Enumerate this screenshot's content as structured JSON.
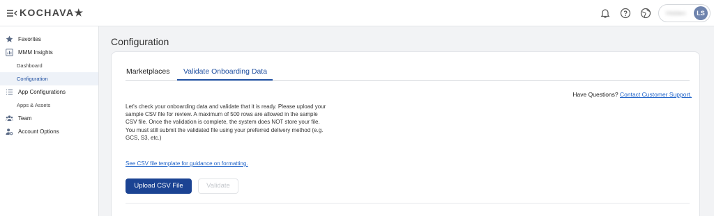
{
  "header": {
    "brand": "KOCHAVA★",
    "user_name": "Hidden",
    "user_initials": "LS"
  },
  "sidebar": {
    "items": [
      {
        "label": "Favorites",
        "icon": "star-icon"
      },
      {
        "label": "MMM Insights",
        "icon": "chart-icon"
      },
      {
        "label": "Dashboard",
        "sub": true
      },
      {
        "label": "Configuration",
        "sub": true,
        "active": true
      },
      {
        "label": "App Configurations",
        "icon": "list-icon"
      },
      {
        "label": "Apps & Assets",
        "sub": true
      },
      {
        "label": "Team",
        "icon": "team-icon"
      },
      {
        "label": "Account Options",
        "icon": "user-settings-icon"
      }
    ]
  },
  "main": {
    "title": "Configuration",
    "tabs": [
      {
        "label": "Marketplaces"
      },
      {
        "label": "Validate Onboarding Data",
        "active": true
      }
    ],
    "questions_text": "Have Questions?",
    "support_link": "Contact Customer Support.",
    "description": "Let's check your onboarding data and validate that it is ready. Please upload your sample CSV file for review. A maximum of 500 rows are allowed in the sample CSV file. Once the validation is complete, the system does NOT store your file. You must still submit the validated file using your preferred delivery method (e.g. GCS, S3, etc.)",
    "template_link": "See CSV file template for guidance on formatting.",
    "upload_button": "Upload CSV File",
    "validate_button": "Validate"
  },
  "colors": {
    "accent": "#1e4ea0",
    "primary_button": "#1b4393",
    "link": "#1e62c8",
    "avatar": "#6e83ad"
  }
}
